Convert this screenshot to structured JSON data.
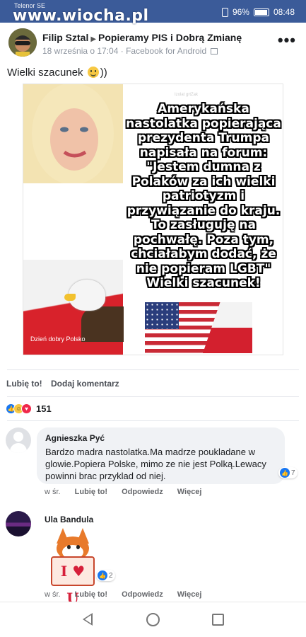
{
  "status_bar": {
    "carrier": "Telenor SE",
    "watermark": "www.wiocha.pl",
    "battery": "96%",
    "time": "08:48"
  },
  "post": {
    "author": "Filip Sztal",
    "group": "Popieramy PIS i Dobrą Zmianę",
    "meta": "18 września o 17:04 · Facebook for Android",
    "text": "Wielki szacunek",
    "text_suffix": "))",
    "image": {
      "credit": "Izolat grtZak",
      "caption_eagle": "Dzień dobry Polsko",
      "quote": "Amerykańska nastolatka popierająca prezydenta Trumpa napisała na forum: \"Jestem dumna z Polaków za ich wielki patriotyzm i przywiązanie do kraju. To zasługuję na pochwałę. Poza tym, chciałabym dodać, że nie popieram LGBT\" Wielki szacunek!"
    },
    "actions": {
      "like": "Lubię to!",
      "comment": "Dodaj komentarz"
    },
    "reaction_count": "151"
  },
  "comments": [
    {
      "author": "Agnieszka Pyć",
      "text": "Bardzo madra nastolatka.Ma madrze poukladane w glowie.Popiera Polske, mimo ze nie jest Polką.Lewacy powinni brac przyklad od niej.",
      "likes": "7",
      "time": "w śr.",
      "like_label": "Lubię to!",
      "reply_label": "Odpowiedz",
      "more_label": "Więcej"
    },
    {
      "author": "Ula Bandula",
      "sticker_text": "I ♥ U",
      "likes": "2",
      "time": "w śr.",
      "like_label": "Lubię to!",
      "reply_label": "Odpowiedz",
      "more_label": "Więcej"
    }
  ],
  "colors": {
    "status_bar": "#3b5b99",
    "like_blue": "#1877f2",
    "bubble": "#f0f2f5"
  }
}
